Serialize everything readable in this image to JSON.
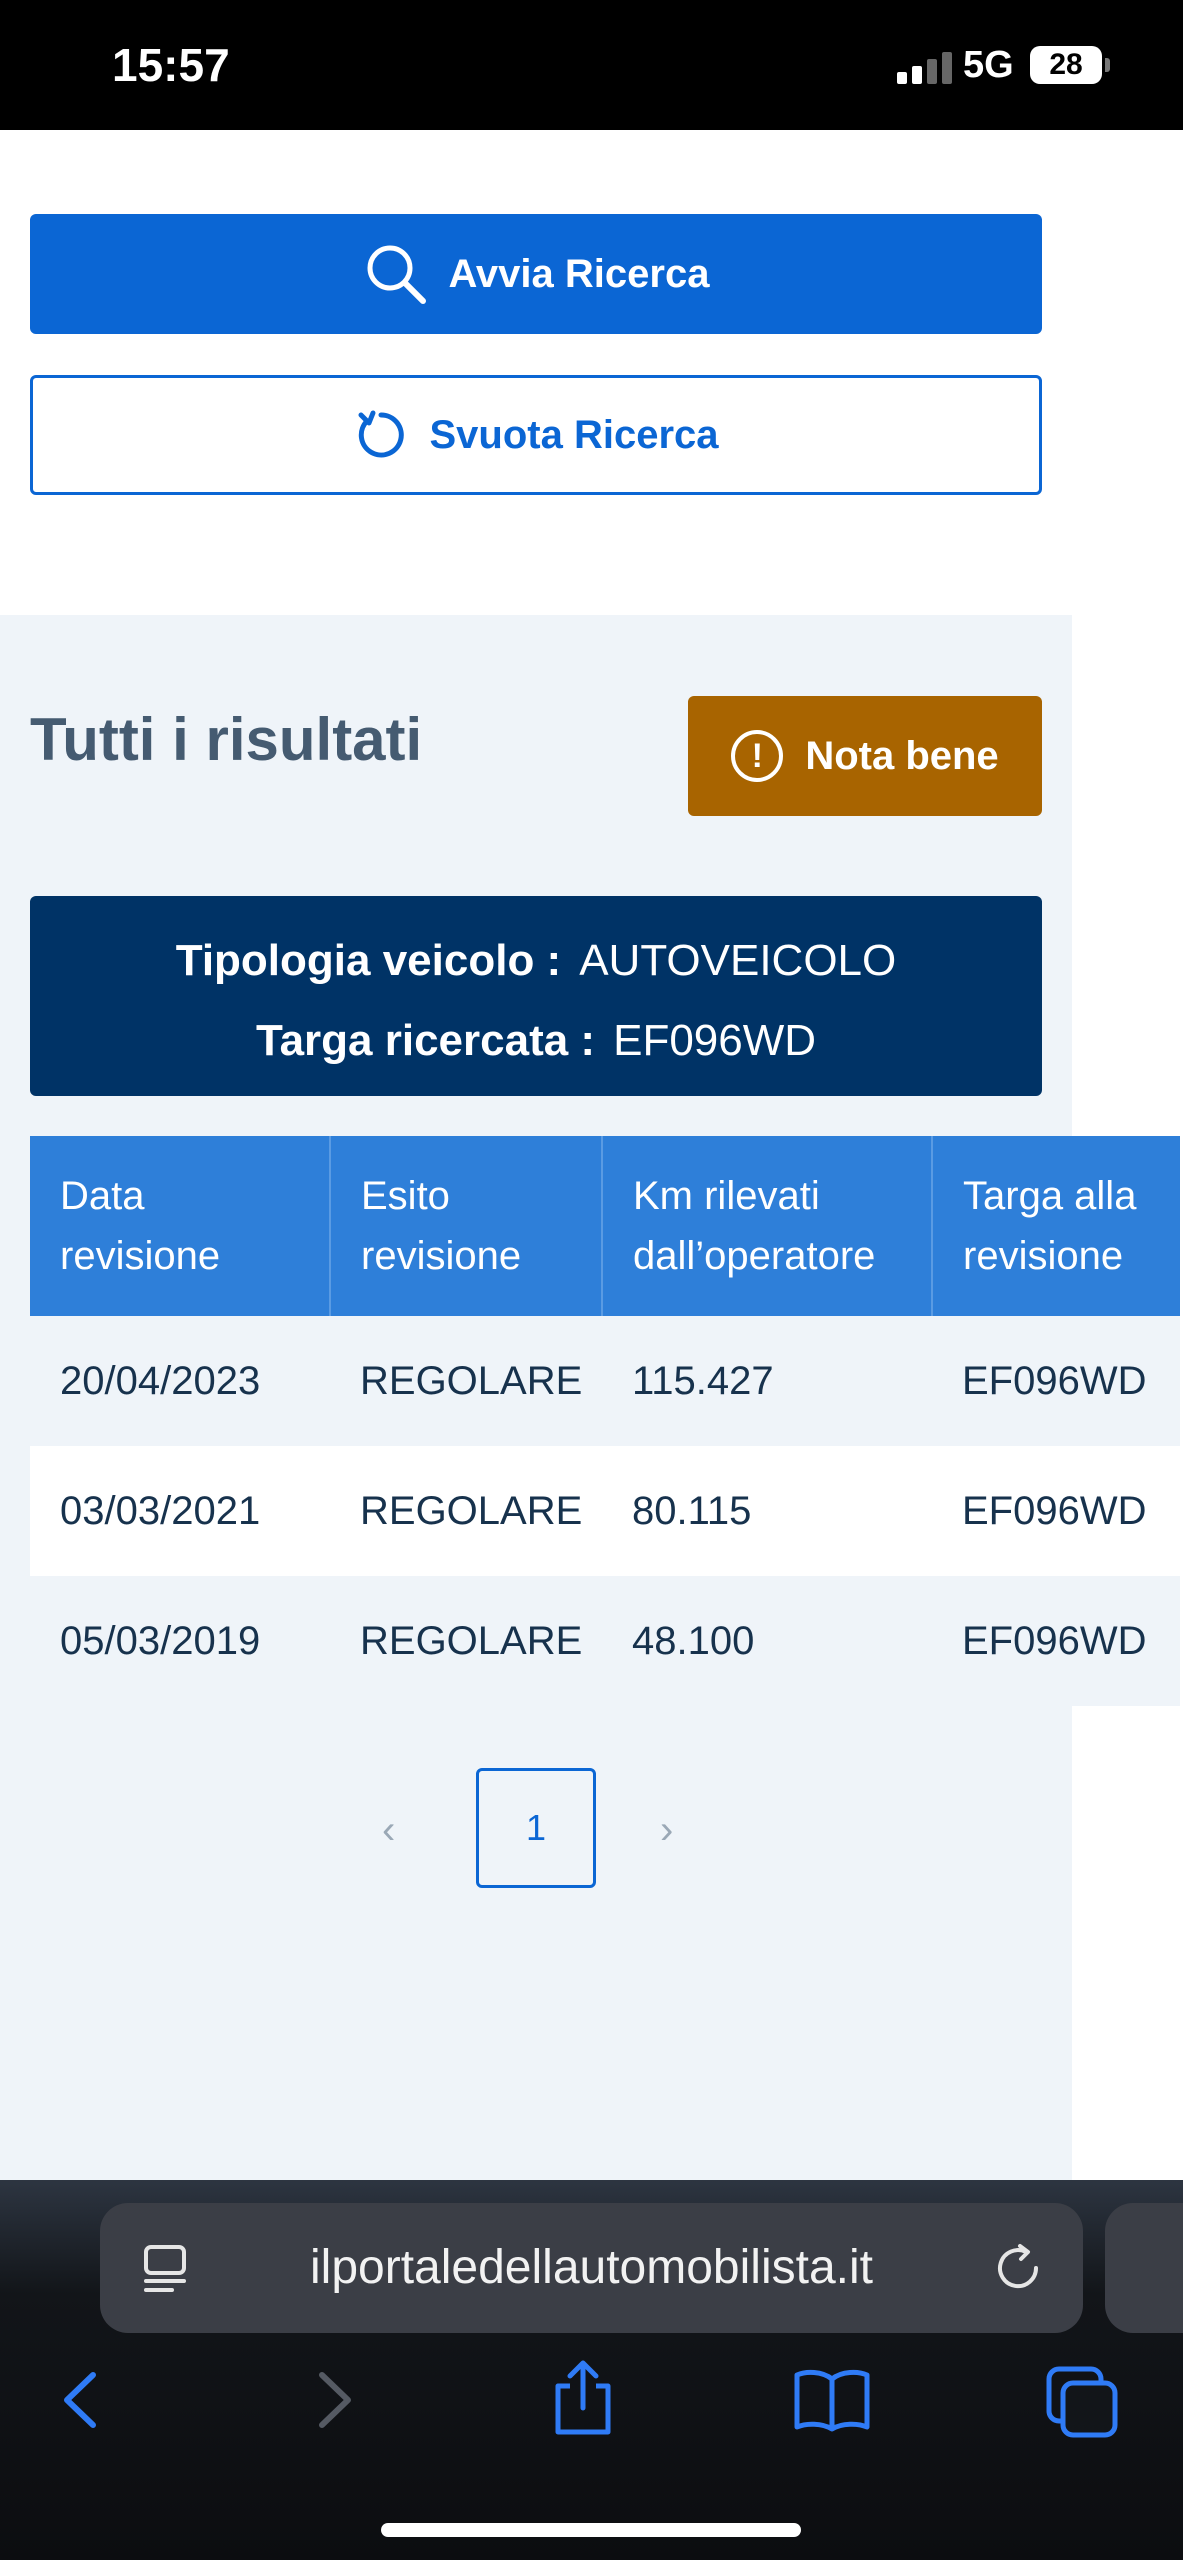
{
  "status_bar": {
    "time": "15:57",
    "network": "5G",
    "battery": "28",
    "signal_bars_active": 2,
    "signal_bars_total": 4
  },
  "actions": {
    "search_label": "Avvia Ricerca",
    "clear_label": "Svuota Ricerca"
  },
  "results": {
    "title": "Tutti i risultati",
    "note_label": "Nota bene",
    "note_icon": "!",
    "vehicle_type_label": "Tipologia veicolo :",
    "vehicle_type_value": "AUTOVEICOLO",
    "plate_label": "Targa ricercata :",
    "plate_value": "EF096WD"
  },
  "table": {
    "headers": [
      "Data revisione",
      "Esito revisione",
      "Km rilevati dall’operatore",
      "Targa alla revisione"
    ],
    "rows": [
      [
        "20/04/2023",
        "REGOLARE",
        "115.427",
        "EF096WD"
      ],
      [
        "03/03/2021",
        "REGOLARE",
        "80.115",
        "EF096WD"
      ],
      [
        "05/03/2019",
        "REGOLARE",
        "48.100",
        "EF096WD"
      ]
    ]
  },
  "pagination": {
    "current_page": "1",
    "prev_icon": "‹",
    "next_icon": "›"
  },
  "browser": {
    "url": "ilportaledellautomobilista.it"
  },
  "colors": {
    "primary": "#0b66d4",
    "warning": "#a86400",
    "info_box": "#003366",
    "table_header": "#2e7fd9",
    "results_bg": "#eff4f9"
  }
}
